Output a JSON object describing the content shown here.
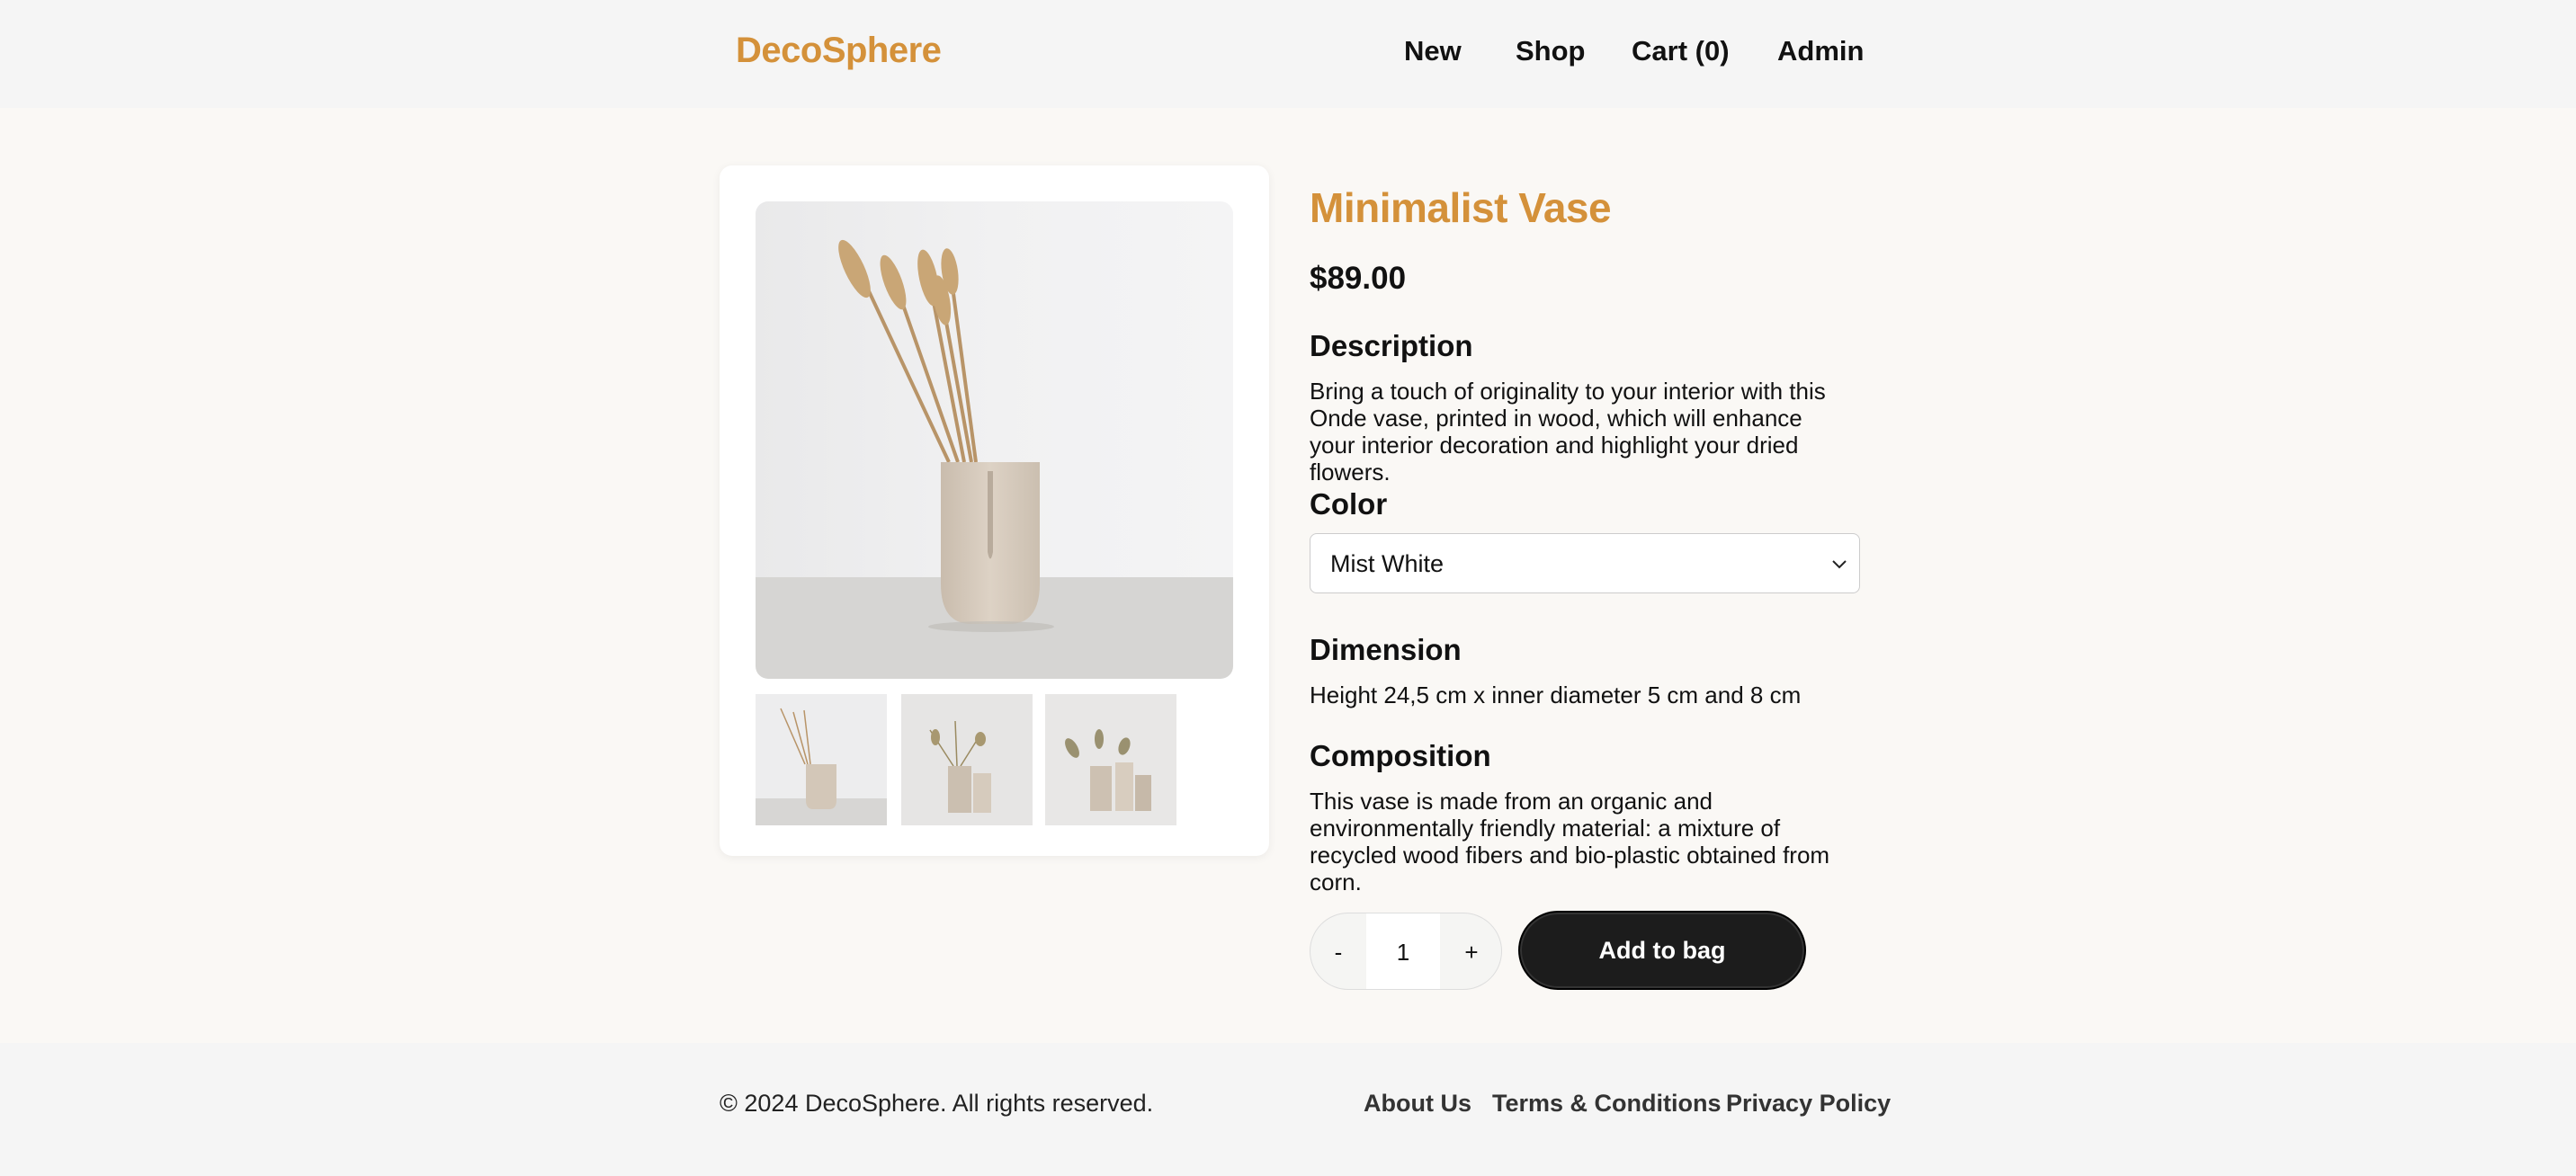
{
  "header": {
    "logo": "DecoSphere",
    "nav": [
      "New",
      "Shop",
      "Cart (0)",
      "Admin"
    ]
  },
  "product": {
    "title": "Minimalist Vase",
    "price": "$89.00",
    "description_heading": "Description",
    "description": "Bring a touch of originality to your interior with this Onde vase, printed in wood, which will enhance your interior decoration and highlight your dried flowers.",
    "color_heading": "Color",
    "color_selected": "Mist White",
    "dimension_heading": "Dimension",
    "dimension": "Height 24,5 cm x inner diameter 5 cm and 8 cm",
    "composition_heading": "Composition",
    "composition": "This vase is made from an organic and environmentally friendly material: a mixture of recycled wood fibers and bio-plastic obtained from corn.",
    "quantity": "1",
    "minus_label": "-",
    "plus_label": "+",
    "add_label": "Add to bag"
  },
  "footer": {
    "copyright": "© 2024 DecoSphere. All rights reserved.",
    "links": [
      "About Us",
      "Terms & Conditions",
      "Privacy Policy"
    ]
  },
  "colors": {
    "accent": "#d4913a",
    "button": "#1c1c1c",
    "background": "#faf8f5"
  }
}
